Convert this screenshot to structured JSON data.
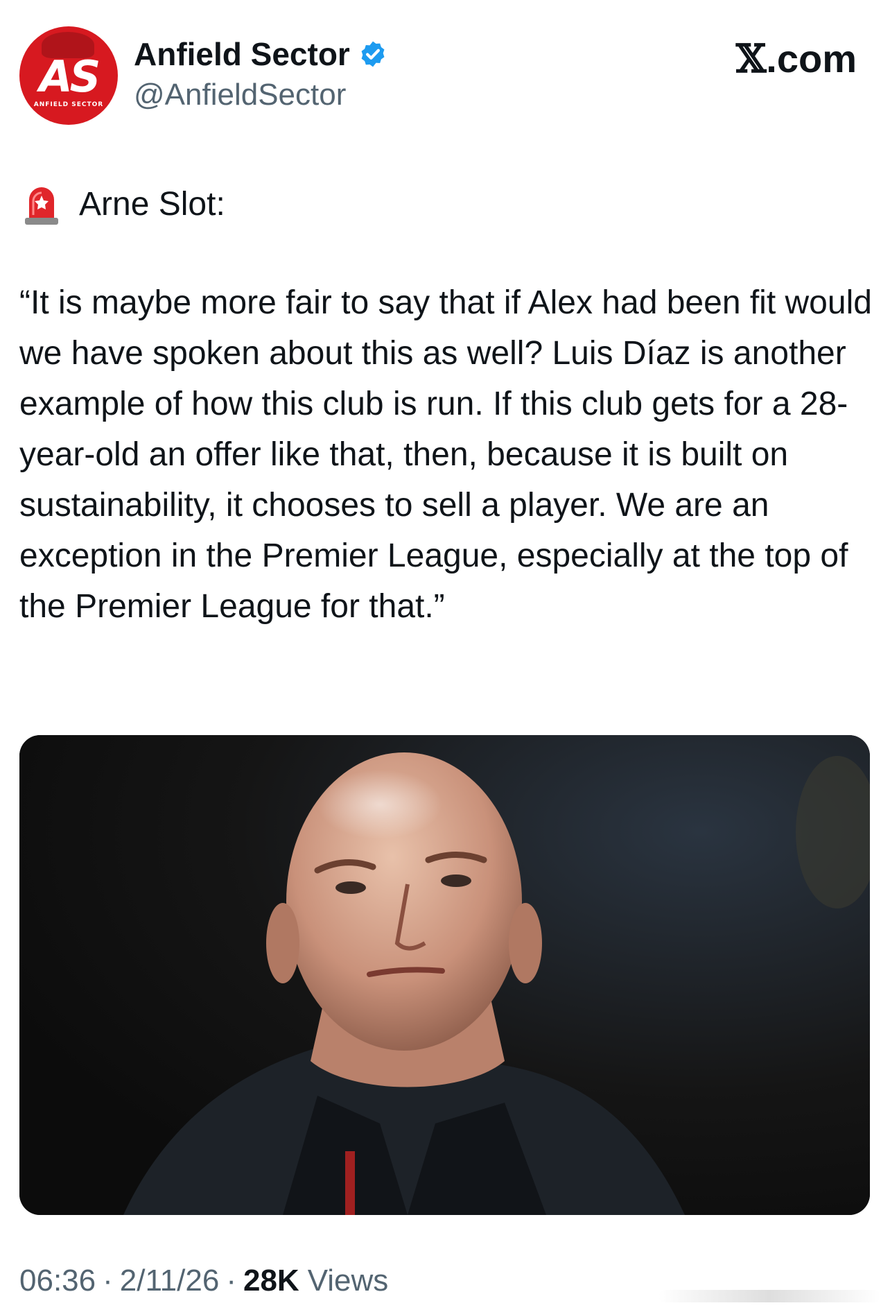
{
  "account": {
    "display_name": "Anfield Sector",
    "handle": "@AnfieldSector",
    "avatar_monogram": "AS",
    "avatar_subtext": "ANFIELD SECTOR",
    "verified": true,
    "avatar_color": "#d71920"
  },
  "site": {
    "label": ".com",
    "icon": "x-logo"
  },
  "post": {
    "label_icon": "siren-icon",
    "label": "Arne Slot:",
    "quote": "“It is maybe more fair to say that if Alex had been fit would we have spoken about this as well? Luis Díaz is another example of how this club is run. If this club gets for a 28-year-old an offer like that, then, because it is built on sustainability, it chooses to sell a player. We are an exception in the Premier League, especially at the top of the Premier League for that.”",
    "image_icon": "photo-arne-slot"
  },
  "meta": {
    "time": "06:36",
    "separator": "·",
    "date": "2/11/26",
    "views_count": "28K",
    "views_label": "Views"
  },
  "colors": {
    "text_primary": "#0f1419",
    "text_secondary": "#536471",
    "verified_blue": "#1d9bf0"
  }
}
